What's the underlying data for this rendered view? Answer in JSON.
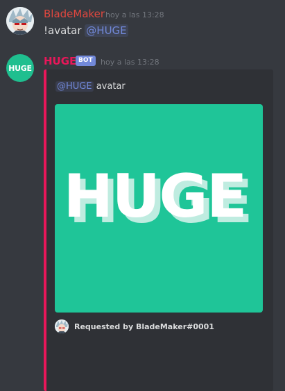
{
  "messages": [
    {
      "username": "BladeMaker",
      "timestamp": "hoy a las 13:28",
      "command": "!avatar",
      "mention": "@HUGE",
      "avatar_icon": "anime-character-avatar",
      "username_color": "#e0473f"
    },
    {
      "username": "HUGE",
      "bot_tag": "BOT",
      "timestamp": "hoy a las 13:28",
      "avatar_text": "HUGE",
      "avatar_color": "#1fbf8f",
      "username_color": "#e9175a",
      "embed": {
        "accent_color": "#e9175a",
        "description_mention": "@HUGE",
        "description_text": "avatar",
        "image_text": "HUGE",
        "image_bg": "#1fc598",
        "footer_text": "Requested by BladeMaker#0001",
        "footer_icon": "anime-character-avatar"
      }
    }
  ],
  "colors": {
    "background": "#36393f",
    "embed_bg": "#2f3136",
    "mention_text": "#7289da",
    "bot_tag_bg": "#7289da"
  }
}
